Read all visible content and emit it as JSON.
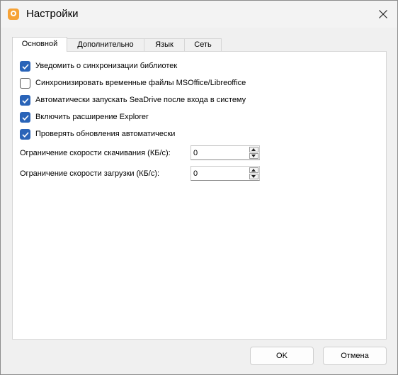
{
  "window": {
    "title": "Настройки",
    "app_icon": "seadrive-app-icon",
    "close_icon": "close-icon"
  },
  "tabs": [
    {
      "label": "Основной",
      "active": true
    },
    {
      "label": "Дополнительно",
      "active": false
    },
    {
      "label": "Язык",
      "active": false
    },
    {
      "label": "Сеть",
      "active": false
    }
  ],
  "general": {
    "checkboxes": [
      {
        "label": "Уведомить о синхронизации библиотек",
        "checked": true
      },
      {
        "label": "Синхронизировать временные файлы MSOffice/Libreoffice",
        "checked": false
      },
      {
        "label": "Автоматически запускать SeaDrive после входа в систему",
        "checked": true
      },
      {
        "label": "Включить расширение Explorer",
        "checked": true
      },
      {
        "label": "Проверять обновления автоматически",
        "checked": true
      }
    ],
    "download_limit": {
      "label": "Ограничение скорости скачивания (КБ/с):",
      "value": "0"
    },
    "upload_limit": {
      "label": "Ограничение скорости загрузки (КБ/с):",
      "value": "0"
    }
  },
  "buttons": {
    "ok": "OK",
    "cancel": "Отмена"
  },
  "colors": {
    "checkbox_checked": "#2a64b8",
    "window_bg": "#f0f0f0",
    "panel_bg": "#ffffff",
    "icon_accent": "#f6a236"
  }
}
